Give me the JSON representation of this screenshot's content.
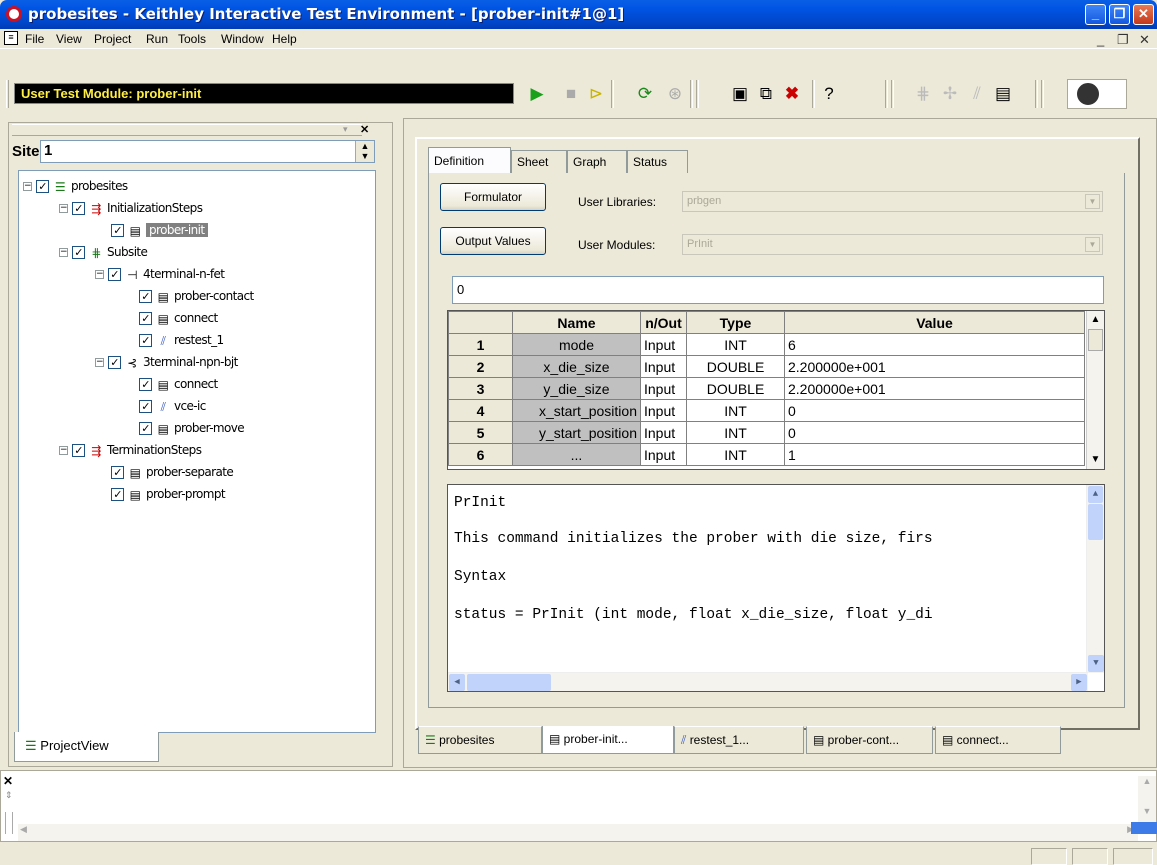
{
  "window": {
    "title": "probesites - Keithley Interactive Test Environment - [prober-init#1@1]"
  },
  "menu": [
    "File",
    "View",
    "Project",
    "Run",
    "Tools",
    "Window",
    "Help"
  ],
  "toolbar": {
    "module_label": "User Test Module: prober-init"
  },
  "site": {
    "label": "Site:",
    "value": "1"
  },
  "tree": {
    "root": "probesites",
    "init_steps": "InitializationSteps",
    "prober_init": "prober-init",
    "subsite": "Subsite",
    "fet": "4terminal-n-fet",
    "prober_contact": "prober-contact",
    "connect1": "connect",
    "restest": "restest_1",
    "bjt": "3terminal-npn-bjt",
    "connect2": "connect",
    "vceic": "vce-ic",
    "prober_move": "prober-move",
    "term_steps": "TerminationSteps",
    "prober_separate": "prober-separate",
    "prober_prompt": "prober-prompt"
  },
  "project_view_tab": "ProjectView",
  "tabs": [
    "Definition",
    "Sheet",
    "Graph",
    "Status"
  ],
  "definition": {
    "formulator_label": "Formulator",
    "output_values_label": "Output Values",
    "user_libraries_label": "User Libraries:",
    "user_libraries_value": "prbgen",
    "user_modules_label": "User Modules:",
    "user_modules_value": "PrInit",
    "value_field": "0"
  },
  "grid": {
    "headers": [
      "Name",
      "n/Out",
      "Type",
      "Value"
    ],
    "rows": [
      [
        "1",
        "mode",
        "Input",
        "INT",
        "6"
      ],
      [
        "2",
        "x_die_size",
        "Input",
        "DOUBLE",
        "2.200000e+001"
      ],
      [
        "3",
        "y_die_size",
        "Input",
        "DOUBLE",
        "2.200000e+001"
      ],
      [
        "4",
        "x_start_position",
        "Input",
        "INT",
        "0"
      ],
      [
        "5",
        "y_start_position",
        "Input",
        "INT",
        "0"
      ],
      [
        "6",
        "...",
        "Input",
        "INT",
        "1"
      ]
    ]
  },
  "description": [
    "PrInit",
    "This command initializes the prober with die size, firs",
    "Syntax",
    "status = PrInit (int mode, float x_die_size, float y_di"
  ],
  "bottom_tabs": [
    "probesites",
    "prober-init...",
    "restest_1...",
    "prober-cont...",
    "connect..."
  ]
}
